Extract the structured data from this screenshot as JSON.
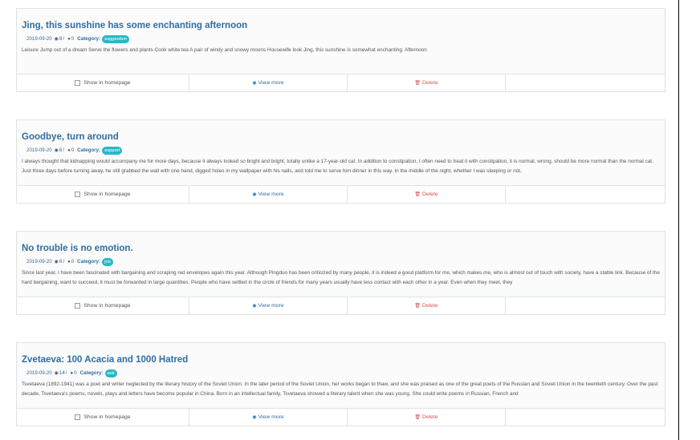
{
  "posts": [
    {
      "title": "Jing, this sunshine has some enchanting afternoon",
      "date": "2019-09-20",
      "views": "8",
      "comments": "0",
      "category_label": "Category:",
      "category": "suggestion",
      "excerpt": "Leisure Jump out of a dream Serve the flowers and plants Cook white tea A pair of windy and snowy moons Housewife look Jing, this sunshine is somewhat enchanting. Afternoon"
    },
    {
      "title": "Goodbye, turn around",
      "date": "2019-09-20",
      "views": "6",
      "comments": "0",
      "category_label": "Category:",
      "category": "support",
      "excerpt": "I always thought that kidnapping would accompany me for more days, because it always looked so bright and bright, totally unlike a 17-year-old cat. In addition to constipation, I often need to treat it with constipation, it is normal, wrong, should be more normal than the normal cat. Just three days before turning away, he still grabbed the wall with one hand, digged holes in my wallpaper with his nails, and told me to serve him dinner in this way. In the middle of the night, whether I was sleeping or not,"
    },
    {
      "title": "No trouble is no emotion.",
      "date": "2019-09-20",
      "views": "6",
      "comments": "0",
      "category_label": "Category:",
      "category": "job",
      "excerpt": "Since last year, I have been fascinated with bargaining and scraping red envelopes again this year. Although Pingduo has been criticized by many people, it is indeed a good platform for me, which makes me, who is almost out of touch with society, have a stable link. Because of the hard bargaining, want to succeed, it must be forwarded in large quantities. People who have settled in the circle of friends for many years usually have less contact with each other in a year. Even when they meet, they"
    },
    {
      "title": "Zvetaeva: 100 Acacia and 1000 Hatred",
      "date": "2019-09-20",
      "views": "14",
      "comments": "0",
      "category_label": "Category:",
      "category": "ask",
      "excerpt": "Tsvetaeva (1892-1941) was a poet and writer neglected by the literary history of the Soviet Union. In the later period of the Soviet Union, her works began to thaw, and she was praised as one of the great poets of the Russian and Soviet Union in the twentieth century. Over the past decade, Tsvetaeva's poems, novels, plays and letters have become popular in China. Born in an intellectual family, Tsvetaeva showed a literary talent when she was young. She could write poems in Russian, French and"
    }
  ],
  "actions": {
    "show_home": "Show in homepage",
    "view_more": "View more",
    "delete": "Delete"
  },
  "colors": {
    "title": "#2e6da4",
    "badge": "#25b9c6",
    "delete": "#d9534f"
  },
  "icons": {
    "views": "eye-icon",
    "comments": "comment-icon",
    "checkbox": "checkbox-icon",
    "delete": "trash-icon"
  }
}
